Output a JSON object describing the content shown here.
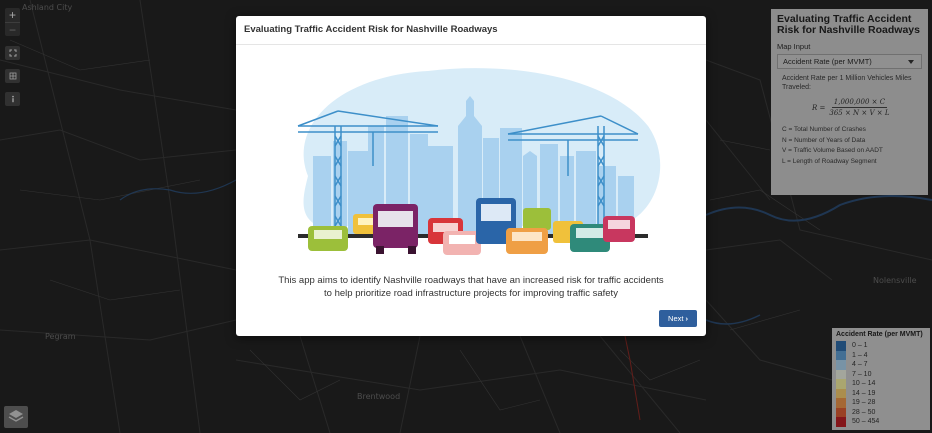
{
  "app_title": "Evaluating Traffic Accident Risk for Nashville Roadways",
  "map": {
    "places": [
      "Ashland City",
      "Pegram",
      "Nolensville",
      "Brentwood"
    ],
    "zoom_in_label": "+",
    "zoom_out_label": "−",
    "basemap_icon": "layers-icon"
  },
  "info_panel": {
    "title": "Evaluating Traffic Accident Risk for Nashville Roadways",
    "input_label": "Map Input",
    "selected_option": "Accident Rate (per MVMT)",
    "rate_label": "Accident Rate per 1 Million Vehicles Miles Traveled:",
    "formula": {
      "lhs": "R =",
      "numerator": "1,000,000 × C",
      "denominator": "365 × N × V × L"
    },
    "definitions": [
      "C = Total Number of Crashes",
      "N = Number of Years of Data",
      "V = Traffic Volume Based on AADT",
      "L = Length of Roadway Segment"
    ]
  },
  "legend": {
    "title": "Accident Rate (per MVMT)",
    "items": [
      {
        "label": "0 – 1",
        "color": "#2e6aa5"
      },
      {
        "label": "1 – 4",
        "color": "#5e9acd"
      },
      {
        "label": "4 – 7",
        "color": "#a7cce6"
      },
      {
        "label": "7 – 10",
        "color": "#e2e6d8"
      },
      {
        "label": "10 – 14",
        "color": "#ece79a"
      },
      {
        "label": "14 – 19",
        "color": "#eec56b"
      },
      {
        "label": "19 – 28",
        "color": "#e59048"
      },
      {
        "label": "28 – 50",
        "color": "#d65a33"
      },
      {
        "label": "50 – 454",
        "color": "#b81f24"
      }
    ]
  },
  "modal": {
    "title": "Evaluating Traffic Accident Risk for Nashville Roadways",
    "description_line1": "This app aims to identify Nashville roadways that have an increased risk for traffic accidents",
    "description_line2": "to help prioritize road infrastructure projects for improving traffic safety",
    "next_label": "Next",
    "accent_color": "#2f5f9d"
  }
}
